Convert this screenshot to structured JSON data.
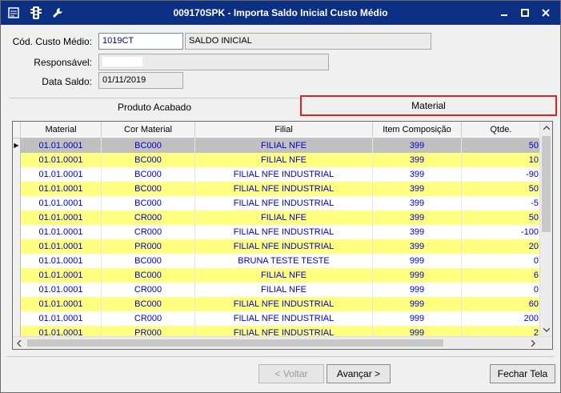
{
  "window": {
    "title": "009170SPK - Importa Saldo Inicial Custo Médio"
  },
  "form": {
    "cod_label": "Cód. Custo Médio:",
    "cod_value": "1019CT",
    "cod_desc": "SALDO INICIAL",
    "resp_label": "Responsável:",
    "resp_value": "",
    "data_label": "Data Saldo:",
    "data_value": "01/11/2019"
  },
  "tabs": {
    "produto": "Produto Acabado",
    "material": "Material"
  },
  "grid": {
    "headers": [
      "Material",
      "Cor Material",
      "Filial",
      "Item Composição",
      "Qtde."
    ],
    "rows": [
      [
        "01.01.0001",
        "BC000",
        "FILIAL NFE",
        "399",
        "50"
      ],
      [
        "01.01.0001",
        "BC000",
        "FILIAL NFE",
        "399",
        "10"
      ],
      [
        "01.01.0001",
        "BC000",
        "FILIAL NFE INDUSTRIAL",
        "399",
        "-90"
      ],
      [
        "01.01.0001",
        "BC000",
        "FILIAL NFE INDUSTRIAL",
        "399",
        "50"
      ],
      [
        "01.01.0001",
        "BC000",
        "FILIAL NFE INDUSTRIAL",
        "399",
        "-5"
      ],
      [
        "01.01.0001",
        "CR000",
        "FILIAL NFE",
        "399",
        "50"
      ],
      [
        "01.01.0001",
        "CR000",
        "FILIAL NFE INDUSTRIAL",
        "399",
        "-100"
      ],
      [
        "01.01.0001",
        "PR000",
        "FILIAL NFE INDUSTRIAL",
        "399",
        "20"
      ],
      [
        "01.01.0001",
        "BC000",
        "BRUNA TESTE TESTE",
        "999",
        "0"
      ],
      [
        "01.01.0001",
        "BC000",
        "FILIAL NFE",
        "999",
        "6"
      ],
      [
        "01.01.0001",
        "CR000",
        "FILIAL NFE",
        "999",
        "0"
      ],
      [
        "01.01.0001",
        "BC000",
        "FILIAL NFE INDUSTRIAL",
        "999",
        "60"
      ],
      [
        "01.01.0001",
        "CR000",
        "FILIAL NFE INDUSTRIAL",
        "999",
        "200"
      ],
      [
        "01.01.0001",
        "PR000",
        "FILIAL NFE INDUSTRIAL",
        "999",
        "2"
      ]
    ]
  },
  "buttons": {
    "voltar": "< Voltar",
    "avancar": "Avançar >",
    "fechar": "Fechar Tela"
  },
  "colors": {
    "titlebar": "#0b2f82",
    "row_highlight": "#ffff80",
    "cell_text": "#0000c8",
    "tab_highlight_border": "#e02020"
  }
}
